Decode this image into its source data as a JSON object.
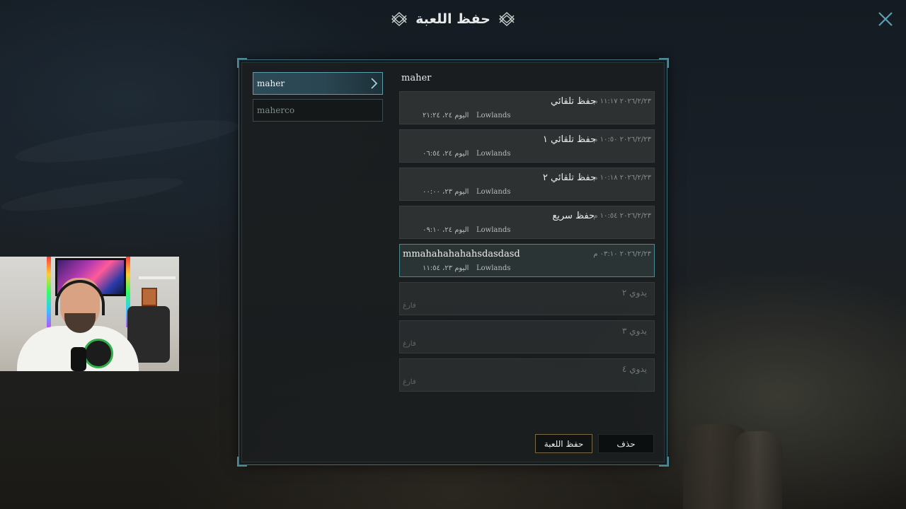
{
  "header": {
    "title": "حفظ اللعبة",
    "close_icon": "close-x-icon",
    "ornament_icon": "knot-ornament-icon"
  },
  "colors": {
    "accent": "#4e8a98",
    "active_profile": "#2d4a56",
    "save_button_border": "#7a6a46"
  },
  "profiles": [
    {
      "name": "maher",
      "active": true
    },
    {
      "name": "maherco",
      "active": false
    }
  ],
  "selected_profile_title": "maher",
  "slots": [
    {
      "name": "حفظ تلقائي",
      "date": "٢٠٢٦/٢/٢٣ ١١:١٧ م",
      "location": "Lowlands",
      "playtime": "اليوم ٢٤، ٢١:٢٤"
    },
    {
      "name": "حفظ تلقائي ١",
      "date": "٢٠٢٦/٢/٢٣ ١٠:٥٠ م",
      "location": "Lowlands",
      "playtime": "اليوم ٢٤، ٠٦:٥٤"
    },
    {
      "name": "حفظ تلقائي ٢",
      "date": "٢٠٢٦/٢/٢٣ ١٠:١٨ م",
      "location": "Lowlands",
      "playtime": "اليوم ٢٣، ٠٠:٠٠"
    },
    {
      "name": "حفظ سريع",
      "date": "٢٠٢٦/٢/٢٣ ١٠:٥٤ م",
      "location": "Lowlands",
      "playtime": "اليوم ٢٤، ٠٩:١٠"
    },
    {
      "name": "mmahahahahahsdasdasd",
      "date": "٢٠٢٦/٢/٢٣ ٠٣:١٠ م",
      "location": "Lowlands",
      "playtime": "اليوم ٢٣، ١١:٥٤"
    }
  ],
  "empty_slots": [
    {
      "name": "يدوي ٢",
      "status": "فارغ"
    },
    {
      "name": "يدوي ٣",
      "status": "فارغ"
    },
    {
      "name": "يدوي ٤",
      "status": "فارغ"
    }
  ],
  "buttons": {
    "save": "حفظ اللعبة",
    "delete": "حذف"
  }
}
